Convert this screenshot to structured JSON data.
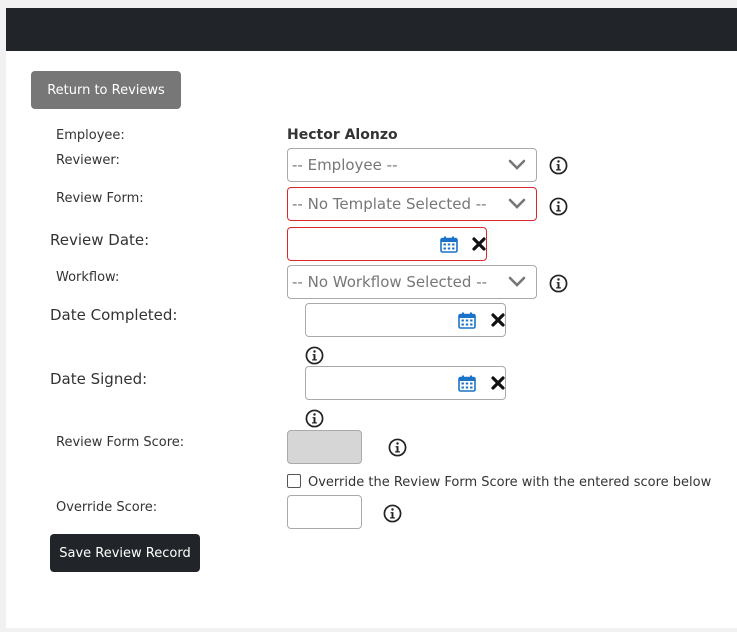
{
  "buttons": {
    "return_label": "Return to Reviews",
    "save_label": "Save Review Record"
  },
  "form": {
    "employee_label": "Employee:",
    "employee_value": "Hector Alonzo",
    "reviewer_label": "Reviewer:",
    "reviewer_value": "-- Employee --",
    "review_form_label": "Review Form:",
    "review_form_value": "-- No Template Selected --",
    "review_date_label": "Review Date:",
    "workflow_label": "Workflow:",
    "workflow_value": "-- No Workflow Selected --",
    "date_completed_label": "Date Completed:",
    "date_signed_label": "Date Signed:",
    "review_form_score_label": "Review Form Score:",
    "override_checkbox_label": "Override the Review Form Score with the entered score below",
    "override_score_label": "Override Score:"
  },
  "icons": {
    "calendar": "calendar-icon",
    "clear": "clear-x-icon",
    "info": "info-icon",
    "chevron": "chevron-down-icon"
  },
  "colors": {
    "header": "#212529",
    "invalid_border": "#d9272e",
    "calendar_blue": "#1a73c8",
    "return_button": "#777777"
  }
}
